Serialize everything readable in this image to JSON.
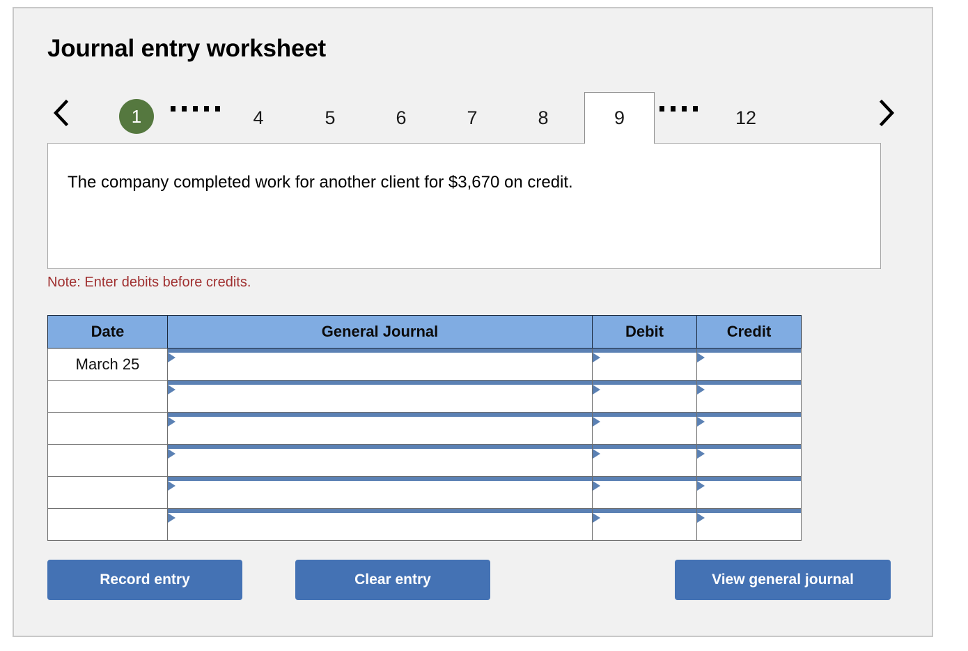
{
  "page": {
    "title": "Journal entry worksheet"
  },
  "nav": {
    "prev_icon": "chevron-left-icon",
    "next_icon": "chevron-right-icon",
    "tabs": [
      {
        "label": "1",
        "type": "pill",
        "state": "completed"
      },
      {
        "label": "",
        "type": "dots",
        "count": 5
      },
      {
        "label": "4",
        "type": "tab",
        "state": "normal"
      },
      {
        "label": "5",
        "type": "tab",
        "state": "normal"
      },
      {
        "label": "6",
        "type": "tab",
        "state": "normal"
      },
      {
        "label": "7",
        "type": "tab",
        "state": "normal"
      },
      {
        "label": "8",
        "type": "tab",
        "state": "normal"
      },
      {
        "label": "9",
        "type": "tab",
        "state": "current"
      },
      {
        "label": "",
        "type": "dots",
        "count": 4
      },
      {
        "label": "12",
        "type": "tab",
        "state": "normal"
      }
    ]
  },
  "statement": {
    "text": "The company completed work for another client for $3,670 on credit."
  },
  "note": {
    "text": "Note: Enter debits before credits."
  },
  "table": {
    "headers": [
      "Date",
      "General Journal",
      "Debit",
      "Credit"
    ],
    "rows": [
      {
        "date": "March 25",
        "general_journal": "",
        "debit": "",
        "credit": ""
      },
      {
        "date": "",
        "general_journal": "",
        "debit": "",
        "credit": ""
      },
      {
        "date": "",
        "general_journal": "",
        "debit": "",
        "credit": ""
      },
      {
        "date": "",
        "general_journal": "",
        "debit": "",
        "credit": ""
      },
      {
        "date": "",
        "general_journal": "",
        "debit": "",
        "credit": ""
      },
      {
        "date": "",
        "general_journal": "",
        "debit": "",
        "credit": ""
      }
    ]
  },
  "buttons": {
    "record": "Record entry",
    "clear": "Clear entry",
    "view": "View general journal"
  },
  "colors": {
    "panel_bg": "#f1f1f1",
    "header_blue": "#80ace2",
    "button_blue": "#4472b4",
    "pill_green": "#55783f",
    "note_red": "#a03030",
    "cell_accent": "#5b81b4"
  }
}
